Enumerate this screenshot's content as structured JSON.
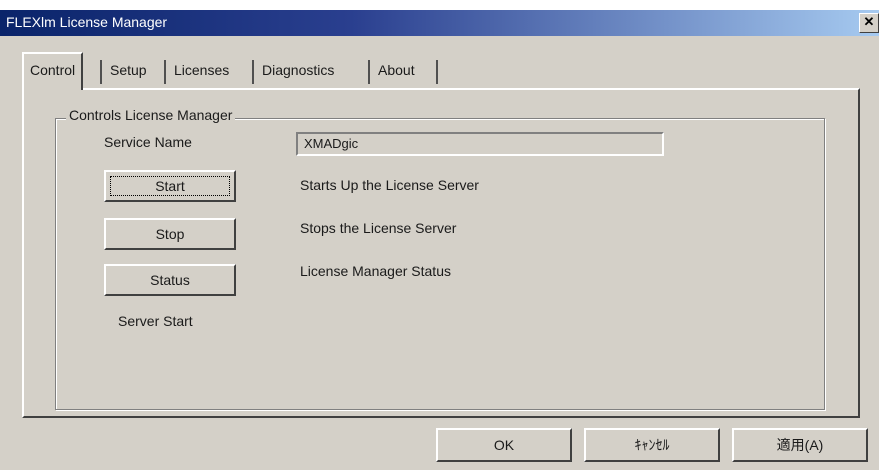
{
  "window": {
    "title": "FLEXlm License Manager",
    "close_label": "✕"
  },
  "tabs": [
    {
      "label": "Control",
      "active": true
    },
    {
      "label": "Setup"
    },
    {
      "label": "Licenses"
    },
    {
      "label": "Diagnostics"
    },
    {
      "label": "About"
    }
  ],
  "group": {
    "title": "Controls License Manager",
    "service_name_label": "Service Name",
    "service_name_value": "XMADgic"
  },
  "actions": {
    "start_label": "Start",
    "start_desc": "Starts Up the License Server",
    "stop_label": "Stop",
    "stop_desc": "Stops the License Server",
    "status_label": "Status",
    "status_desc": "License Manager Status",
    "status_text": "Server Start"
  },
  "footer": {
    "ok_label": "OK",
    "cancel_label": "ｷｬﾝｾﾙ",
    "apply_label": "適用(A)"
  }
}
